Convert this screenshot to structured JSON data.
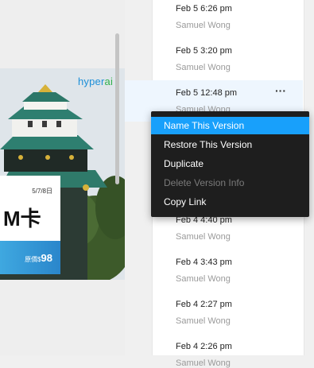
{
  "canvas": {
    "logo_main": "hyper",
    "logo_accent": "ai",
    "ticket": {
      "date": "5/7/8日",
      "title": "M卡",
      "price_label": "原價$",
      "price_value": "98"
    }
  },
  "versions": [
    {
      "time": "Feb 5 6:26 pm",
      "author": "Samuel Wong"
    },
    {
      "time": "Feb 5 3:20 pm",
      "author": "Samuel Wong"
    },
    {
      "time": "Feb 5 12:48 pm",
      "author": "Samuel Wong"
    },
    {
      "time": "Feb 4 4:40 pm",
      "author": "Samuel Wong"
    },
    {
      "time": "Feb 4 3:43 pm",
      "author": "Samuel Wong"
    },
    {
      "time": "Feb 4 2:27 pm",
      "author": "Samuel Wong"
    },
    {
      "time": "Feb 4 2:26 pm",
      "author": "Samuel Wong"
    }
  ],
  "more_icon": "···",
  "context_menu": {
    "items": [
      {
        "label": "Name This Version",
        "state": "active"
      },
      {
        "label": "Restore This Version",
        "state": "normal"
      },
      {
        "label": "Duplicate",
        "state": "normal"
      },
      {
        "label": "Delete Version Info",
        "state": "disabled"
      },
      {
        "label": "Copy Link",
        "state": "normal"
      }
    ]
  },
  "colors": {
    "menu_highlight": "#18a0fb",
    "menu_background": "#1e1e1e",
    "row_hover": "#eef6fe"
  }
}
